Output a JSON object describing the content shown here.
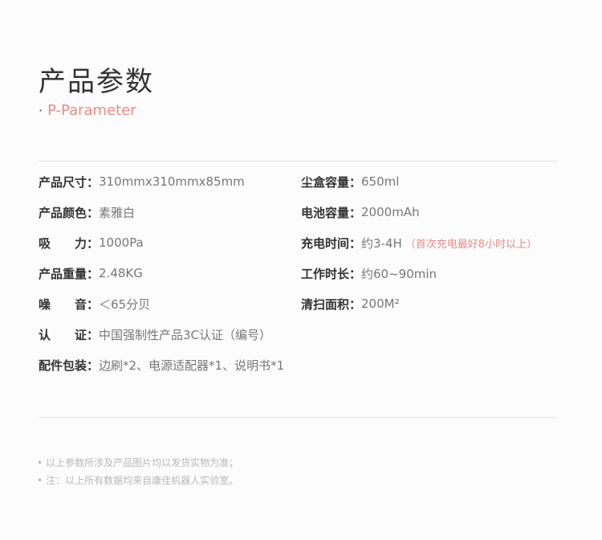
{
  "header": {
    "title": "产品参数",
    "subtitle_dot": "·",
    "subtitle": "P-Parameter"
  },
  "params": {
    "left": [
      {
        "label": "产品尺寸：",
        "value": "310mmx310mmx85mm"
      },
      {
        "label": "产品颜色：",
        "value": "素雅白"
      },
      {
        "label": "吸　　力：",
        "value": "1000Pa"
      },
      {
        "label": "产品重量：",
        "value": "2.48KG"
      },
      {
        "label": "噪　　音：",
        "value": "＜65分贝"
      },
      {
        "label": "认　　证：",
        "value": "中国强制性产品3C认证（编号）"
      },
      {
        "label": "配件包装：",
        "value": "边刷*2、电源适配器*1、说明书*1"
      }
    ],
    "right": [
      {
        "label": "尘盒容量：",
        "value": "650ml"
      },
      {
        "label": "电池容量：",
        "value": "2000mAh"
      },
      {
        "label": "充电时间：",
        "value": "约3-4H",
        "note": "（首次充电最好8小时以上）"
      },
      {
        "label": "工作时长：",
        "value": "约60~90min"
      },
      {
        "label": "清扫面积：",
        "value": "200M²"
      }
    ]
  },
  "footnotes": {
    "bullet": "•",
    "items": [
      "以上参数所涉及产品图片均以发货实物为准；",
      "注：以上所有数据均来自康佳机器人实验室。"
    ]
  },
  "colors": {
    "accent": "#e98a8a",
    "title": "#333333",
    "value": "#777777",
    "footnote": "#b8b8b8",
    "divider": "#e4e4e4"
  }
}
